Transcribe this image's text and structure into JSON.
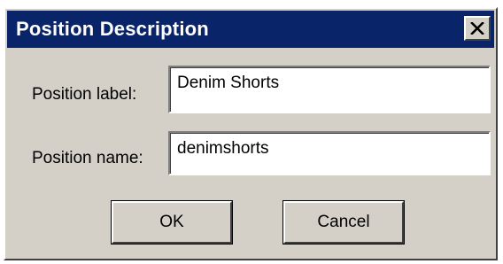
{
  "dialog": {
    "title": "Position Description",
    "close_icon": "close-x-icon"
  },
  "form": {
    "position_label": {
      "label": "Position label:",
      "value": "Denim Shorts"
    },
    "position_name": {
      "label": "Position name:",
      "value": "denimshorts"
    }
  },
  "buttons": {
    "ok": "OK",
    "cancel": "Cancel"
  },
  "colors": {
    "titlebar": "#0a246a",
    "dialog_face": "#d4d0c8"
  }
}
